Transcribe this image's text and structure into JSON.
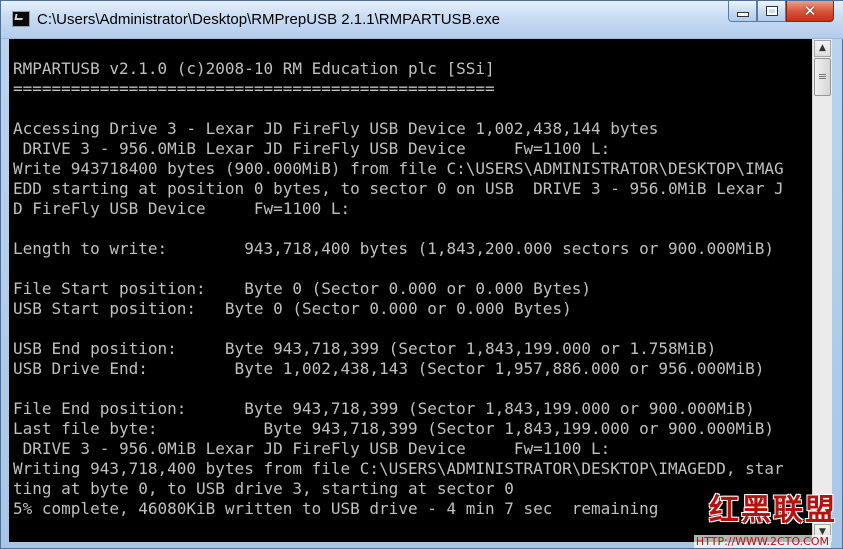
{
  "window": {
    "title": "C:\\Users\\Administrator\\Desktop\\RMPrepUSB 2.1.1\\RMPARTUSB.exe",
    "icon": "console-app-icon"
  },
  "caption_buttons": {
    "minimize": "minimize-icon",
    "maximize": "maximize-icon",
    "close_glyph": "✕"
  },
  "console": {
    "lines": [
      "RMPARTUSB v2.1.0 (c)2008-10 RM Education plc [SSi]",
      "==================================================",
      "",
      "Accessing Drive 3 - Lexar JD FireFly USB Device 1,002,438,144 bytes",
      " DRIVE 3 - 956.0MiB Lexar JD FireFly USB Device     Fw=1100 L:",
      "Write 943718400 bytes (900.000MiB) from file C:\\USERS\\ADMINISTRATOR\\DESKTOP\\IMAG",
      "EDD starting at position 0 bytes, to sector 0 on USB  DRIVE 3 - 956.0MiB Lexar J",
      "D FireFly USB Device     Fw=1100 L:",
      "",
      "Length to write:        943,718,400 bytes (1,843,200.000 sectors or 900.000MiB)",
      "",
      "File Start position:    Byte 0 (Sector 0.000 or 0.000 Bytes)",
      "USB Start position:   Byte 0 (Sector 0.000 or 0.000 Bytes)",
      "",
      "USB End position:     Byte 943,718,399 (Sector 1,843,199.000 or 1.758MiB)",
      "USB Drive End:         Byte 1,002,438,143 (Sector 1,957,886.000 or 956.000MiB)",
      "",
      "File End position:      Byte 943,718,399 (Sector 1,843,199.000 or 900.000MiB)",
      "Last file byte:           Byte 943,718,399 (Sector 1,843,199.000 or 900.000MiB)",
      " DRIVE 3 - 956.0MiB Lexar JD FireFly USB Device     Fw=1100 L:",
      "Writing 943,718,400 bytes from file C:\\USERS\\ADMINISTRATOR\\DESKTOP\\IMAGEDD, star",
      "ting at byte 0, to USB drive 3, starting at sector 0",
      "5% complete, 46080KiB written to USB drive - 4 min 7 sec  remaining"
    ]
  },
  "scrollbar": {
    "up_glyph": "▲",
    "down_glyph": "▼"
  },
  "watermark": {
    "text": "红黑联盟",
    "url": "HTTP://WWW.2CTO.COM"
  }
}
